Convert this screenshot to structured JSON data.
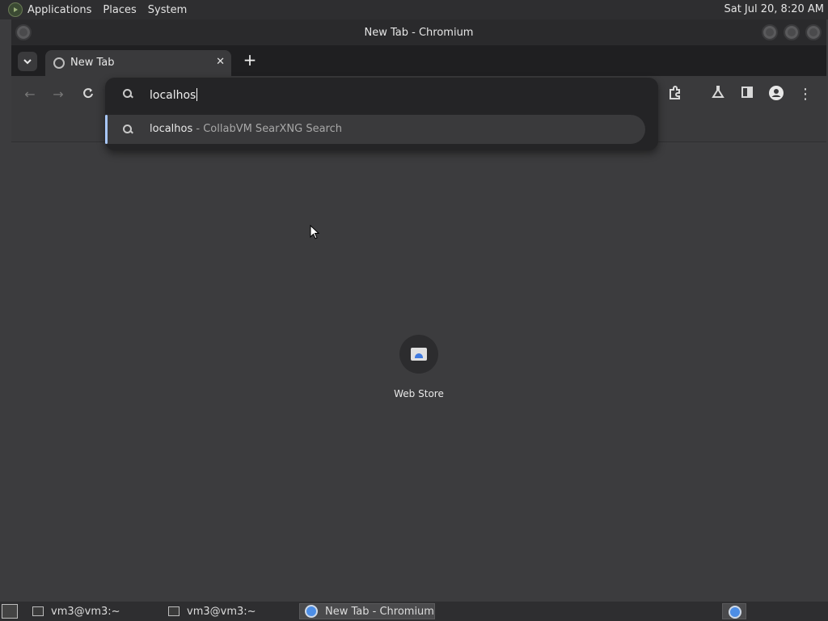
{
  "top_panel": {
    "menus": [
      "Applications",
      "Places",
      "System"
    ],
    "clock": "Sat Jul 20,  8:20 AM"
  },
  "window": {
    "title": "New Tab - Chromium"
  },
  "tabs": [
    {
      "label": "New Tab",
      "active": true
    }
  ],
  "omnibox": {
    "value": "localhos",
    "suggestion": {
      "query": "localhos",
      "description": " - CollabVM SearXNG Search"
    }
  },
  "shortcuts": [
    {
      "label": "Web Store",
      "icon": "web-store-icon"
    }
  ],
  "taskbar": {
    "items": [
      {
        "label": "vm3@vm3:~",
        "icon": "terminal-icon",
        "active": false
      },
      {
        "label": "vm3@vm3:~",
        "icon": "terminal-icon",
        "active": false
      },
      {
        "label": "New Tab - Chromium",
        "icon": "chromium-icon",
        "active": true
      }
    ]
  },
  "colors": {
    "accent": "#a8c7fa",
    "panel": "#2e2e30",
    "content_bg": "#3c3c3e"
  }
}
